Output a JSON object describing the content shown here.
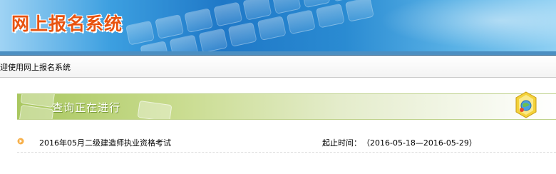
{
  "header": {
    "title": "网上报名系统"
  },
  "welcome": {
    "text": "迎使用网上报名系统"
  },
  "section": {
    "title": "查询正在进行",
    "icon": "diamond-globe-icon"
  },
  "exams": [
    {
      "name": "2016年05月二级建造师执业资格考试",
      "time_label": "起止时间：",
      "time_range": "（2016-05-18—2016-05-29）"
    }
  ],
  "colors": {
    "title_orange": "#e85310",
    "banner_blue": "#1f78c7",
    "section_green": "#a9c760",
    "bullet_orange": "#f08a1c"
  }
}
